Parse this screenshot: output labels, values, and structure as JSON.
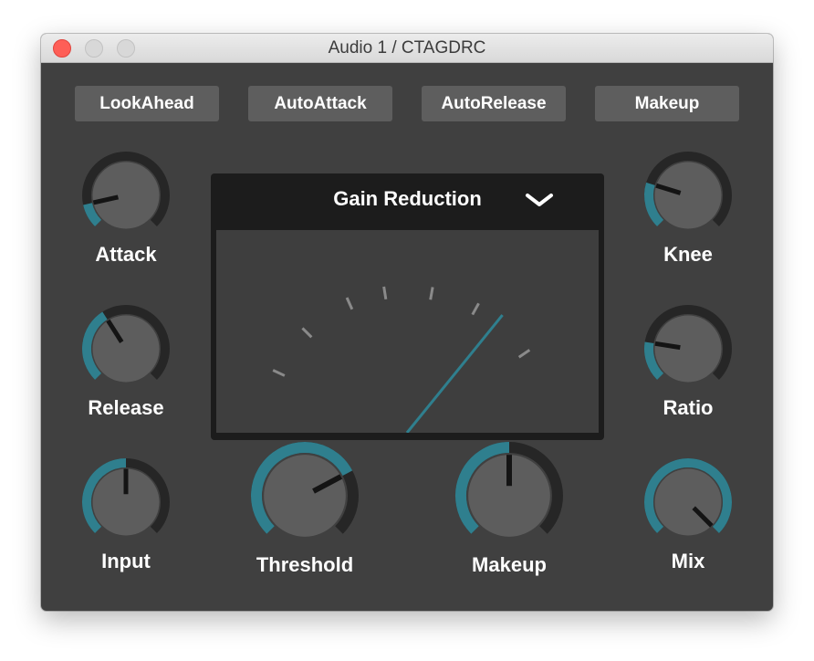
{
  "window": {
    "title": "Audio 1 / CTAGDRC"
  },
  "toggles": [
    {
      "label": "LookAhead"
    },
    {
      "label": "AutoAttack"
    },
    {
      "label": "AutoRelease"
    },
    {
      "label": "Makeup"
    }
  ],
  "meter": {
    "title": "Gain Reduction",
    "dropdown_icon": "chevron-down-icon",
    "needle_level": 0.86
  },
  "knobs": {
    "attack": {
      "label": "Attack",
      "value": 0.12
    },
    "release": {
      "label": "Release",
      "value": 0.38
    },
    "input": {
      "label": "Input",
      "value": 0.5
    },
    "threshold": {
      "label": "Threshold",
      "value": 0.73
    },
    "makeup": {
      "label": "Makeup",
      "value": 0.5
    },
    "knee": {
      "label": "Knee",
      "value": 0.23
    },
    "ratio": {
      "label": "Ratio",
      "value": 0.2
    },
    "mix": {
      "label": "Mix",
      "value": 1.0
    }
  },
  "colors": {
    "accent": "#2f7f8e",
    "panel": "#404040",
    "knob_track": "#262626",
    "knob_body": "#5d5d5d",
    "pointer": "#141414",
    "button": "#5e5e5e",
    "meter_bg": "#1c1c1c",
    "meter_face": "#3e3e3e",
    "tick": "#8a8a8a"
  }
}
